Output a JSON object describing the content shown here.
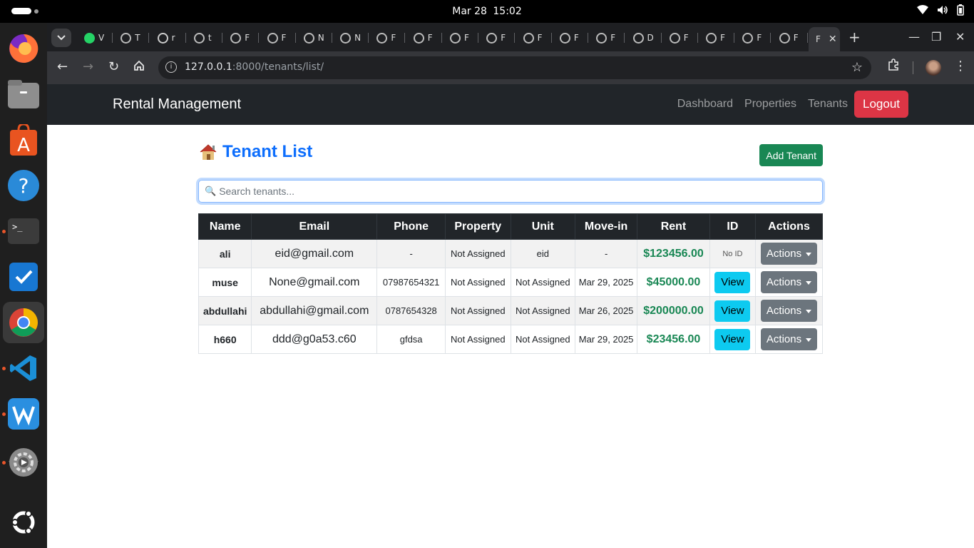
{
  "os": {
    "clock_date": "Mar 28",
    "clock_time": "15:02",
    "dock": [
      "firefox-icon",
      "files-icon",
      "app-center-icon",
      "help-icon",
      "terminal-icon",
      "tasks-icon",
      "chrome-icon",
      "vscode-icon",
      "wps-icon",
      "settings-icon",
      "ubuntu-icon"
    ]
  },
  "browser": {
    "tabs": [
      {
        "label": "V",
        "icon": "whatsapp-icon"
      },
      {
        "label": "T",
        "icon": "globe-icon"
      },
      {
        "label": "r",
        "icon": "github-icon"
      },
      {
        "label": "t",
        "icon": "settings-globe-icon"
      },
      {
        "label": "F",
        "icon": "globe-icon"
      },
      {
        "label": "F",
        "icon": "globe-icon"
      },
      {
        "label": "N",
        "icon": "globe-icon"
      },
      {
        "label": "N",
        "icon": "globe-icon"
      },
      {
        "label": "F",
        "icon": "globe-icon"
      },
      {
        "label": "F",
        "icon": "globe-icon"
      },
      {
        "label": "F",
        "icon": "globe-icon"
      },
      {
        "label": "F",
        "icon": "globe-icon"
      },
      {
        "label": "F",
        "icon": "globe-icon"
      },
      {
        "label": "F",
        "icon": "globe-icon"
      },
      {
        "label": "F",
        "icon": "globe-icon"
      },
      {
        "label": "D",
        "icon": "globe-icon"
      },
      {
        "label": "F",
        "icon": "globe-icon"
      },
      {
        "label": "F",
        "icon": "globe-icon"
      },
      {
        "label": "F",
        "icon": "globe-icon"
      },
      {
        "label": "F",
        "icon": "globe-icon"
      }
    ],
    "active_tab_label": "F",
    "url_host": "127.0.0.1",
    "url_rest": ":8000/tenants/list/"
  },
  "navbar": {
    "brand": "Rental Management",
    "links": [
      "Dashboard",
      "Properties",
      "Tenants"
    ],
    "logout": "Logout"
  },
  "page": {
    "title": "Tenant List",
    "add_button": "Add Tenant",
    "search_placeholder": "Search tenants..."
  },
  "table": {
    "headers": [
      "Name",
      "Email",
      "Phone",
      "Property",
      "Unit",
      "Move-in",
      "Rent",
      "ID",
      "Actions"
    ],
    "rows": [
      {
        "name": "ali",
        "email": "eid@gmail.com",
        "phone": "-",
        "property": "Not Assigned",
        "unit": "eid",
        "move_in": "-",
        "rent": "$123456.00",
        "id": "No ID",
        "actions": "Actions"
      },
      {
        "name": "muse",
        "email": "None@gmail.com",
        "phone": "07987654321",
        "property": "Not Assigned",
        "unit": "Not Assigned",
        "move_in": "Mar 29, 2025",
        "rent": "$45000.00",
        "id": "View",
        "actions": "Actions"
      },
      {
        "name": "abdullahi",
        "email": "abdullahi@gmail.com",
        "phone": "0787654328",
        "property": "Not Assigned",
        "unit": "Not Assigned",
        "move_in": "Mar 26, 2025",
        "rent": "$200000.00",
        "id": "View",
        "actions": "Actions"
      },
      {
        "name": "h660",
        "email": "ddd@g0a53.c60",
        "phone": "gfdsa",
        "property": "Not Assigned",
        "unit": "Not Assigned",
        "move_in": "Mar 29, 2025",
        "rent": "$23456.00",
        "id": "View",
        "actions": "Actions"
      }
    ]
  },
  "colors": {
    "primary": "#0d6efd",
    "success": "#198754",
    "danger": "#dc3545",
    "info": "#0dcaf0",
    "secondary": "#6c757d",
    "dark": "#212529"
  }
}
